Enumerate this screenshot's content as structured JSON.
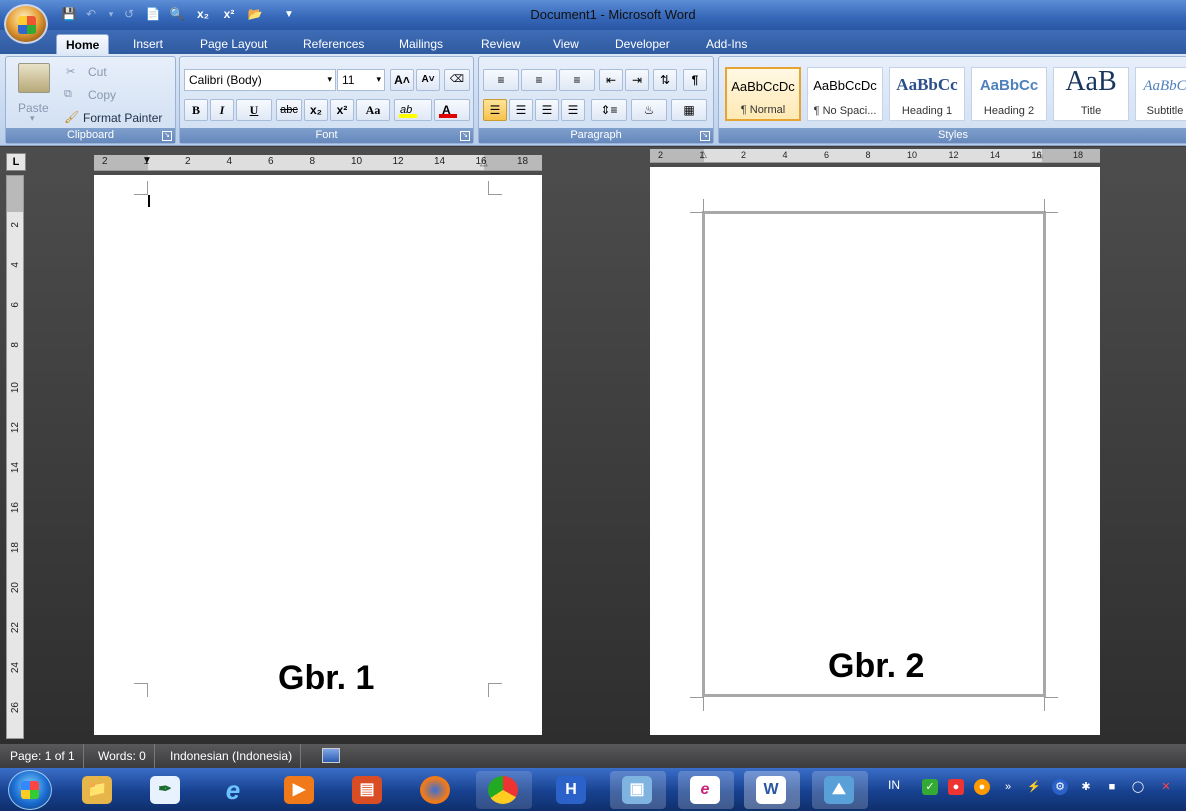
{
  "window": {
    "title": "Document1 - Microsoft Word"
  },
  "quick_access": {
    "icons": [
      "save-icon",
      "undo-icon",
      "redo-icon",
      "new-document-icon",
      "print-preview-icon",
      "subscript-icon",
      "superscript-icon",
      "open-folder-icon",
      "customize-icon"
    ]
  },
  "tabs": [
    "Home",
    "Insert",
    "Page Layout",
    "References",
    "Mailings",
    "Review",
    "View",
    "Developer",
    "Add-Ins"
  ],
  "clipboard": {
    "paste": "Paste",
    "cut": "Cut",
    "copy": "Copy",
    "format_painter": "Format Painter",
    "label": "Clipboard"
  },
  "font": {
    "name": "Calibri (Body)",
    "size": "11",
    "bold": "B",
    "italic": "I",
    "underline": "U",
    "strike": "abc",
    "subscript": "x₂",
    "superscript": "x²",
    "change_case": "Aa",
    "grow": "A˄",
    "shrink": "A˅",
    "highlight": "ab",
    "color": "A",
    "label": "Font",
    "highlight_color": "#ffff00",
    "font_color": "#e00000"
  },
  "paragraph": {
    "label": "Paragraph",
    "pilcrow": "¶"
  },
  "styles": {
    "label": "Styles",
    "items": [
      {
        "sample": "AaBbCcDc",
        "name": "¶ Normal"
      },
      {
        "sample": "AaBbCcDc",
        "name": "¶ No Spaci..."
      },
      {
        "sample": "AaBbCc",
        "name": "Heading 1"
      },
      {
        "sample": "AaBbCc",
        "name": "Heading 2"
      },
      {
        "sample": "AaB",
        "name": "Title"
      },
      {
        "sample": "AaBbC",
        "name": "Subtitle"
      }
    ]
  },
  "ruler": {
    "left_ticks": [
      "2",
      "1",
      "2",
      "4",
      "6",
      "8",
      "10",
      "12",
      "14",
      "16",
      "18"
    ],
    "right_ticks": [
      "2",
      "1",
      "2",
      "4",
      "6",
      "8",
      "10",
      "12",
      "14",
      "16",
      "18"
    ],
    "vertical_ticks": [
      "2",
      "4",
      "6",
      "8",
      "10",
      "12",
      "14",
      "16",
      "18",
      "20",
      "22",
      "24",
      "26"
    ],
    "corner": "L"
  },
  "pages": {
    "left_caption": "Gbr. 1",
    "right_caption": "Gbr. 2"
  },
  "status": {
    "page": "Page: 1 of 1",
    "words": "Words: 0",
    "language": "Indonesian (Indonesia)"
  },
  "taskbar": {
    "apps": [
      "explorer-icon",
      "ink-pen-icon",
      "internet-explorer-icon",
      "media-player-icon",
      "book-icon",
      "firefox-icon",
      "chrome-icon",
      "h-app-icon",
      "image-viewer-icon",
      "smartsheet-icon",
      "word-icon",
      "picture-icon"
    ],
    "language": "IN"
  }
}
